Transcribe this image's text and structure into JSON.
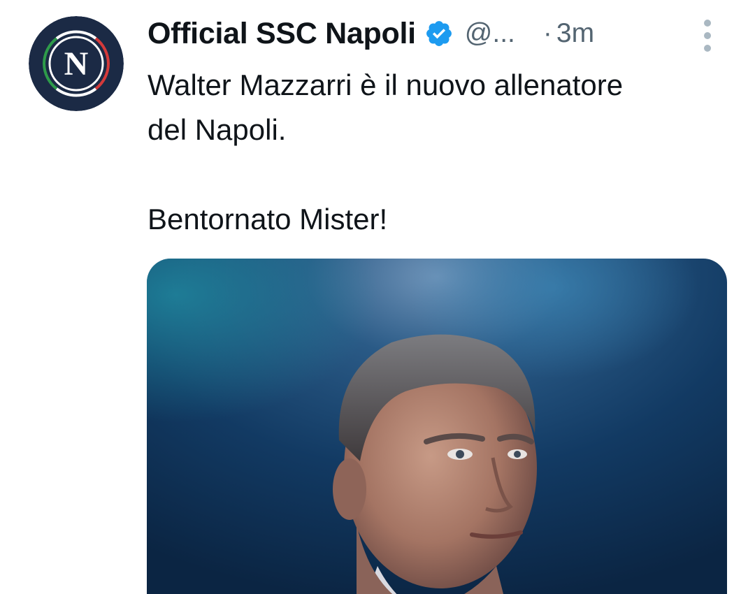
{
  "tweet": {
    "display_name": "Official SSC Napoli",
    "handle": "@...",
    "separator": "·",
    "time": "3m",
    "text_lines": [
      "Walter Mazzarri è il nuovo allenatore",
      "del Napoli."
    ],
    "text_line_2": "Bentornato Mister!",
    "avatar_letter": "N",
    "colors": {
      "name": "#0f1419",
      "secondary": "#536471",
      "verified": "#1d9bf0",
      "avatar_bg": "#1b2a45"
    },
    "icons": {
      "verified": "verified-badge-icon",
      "more": "more-vertical-icon"
    }
  }
}
